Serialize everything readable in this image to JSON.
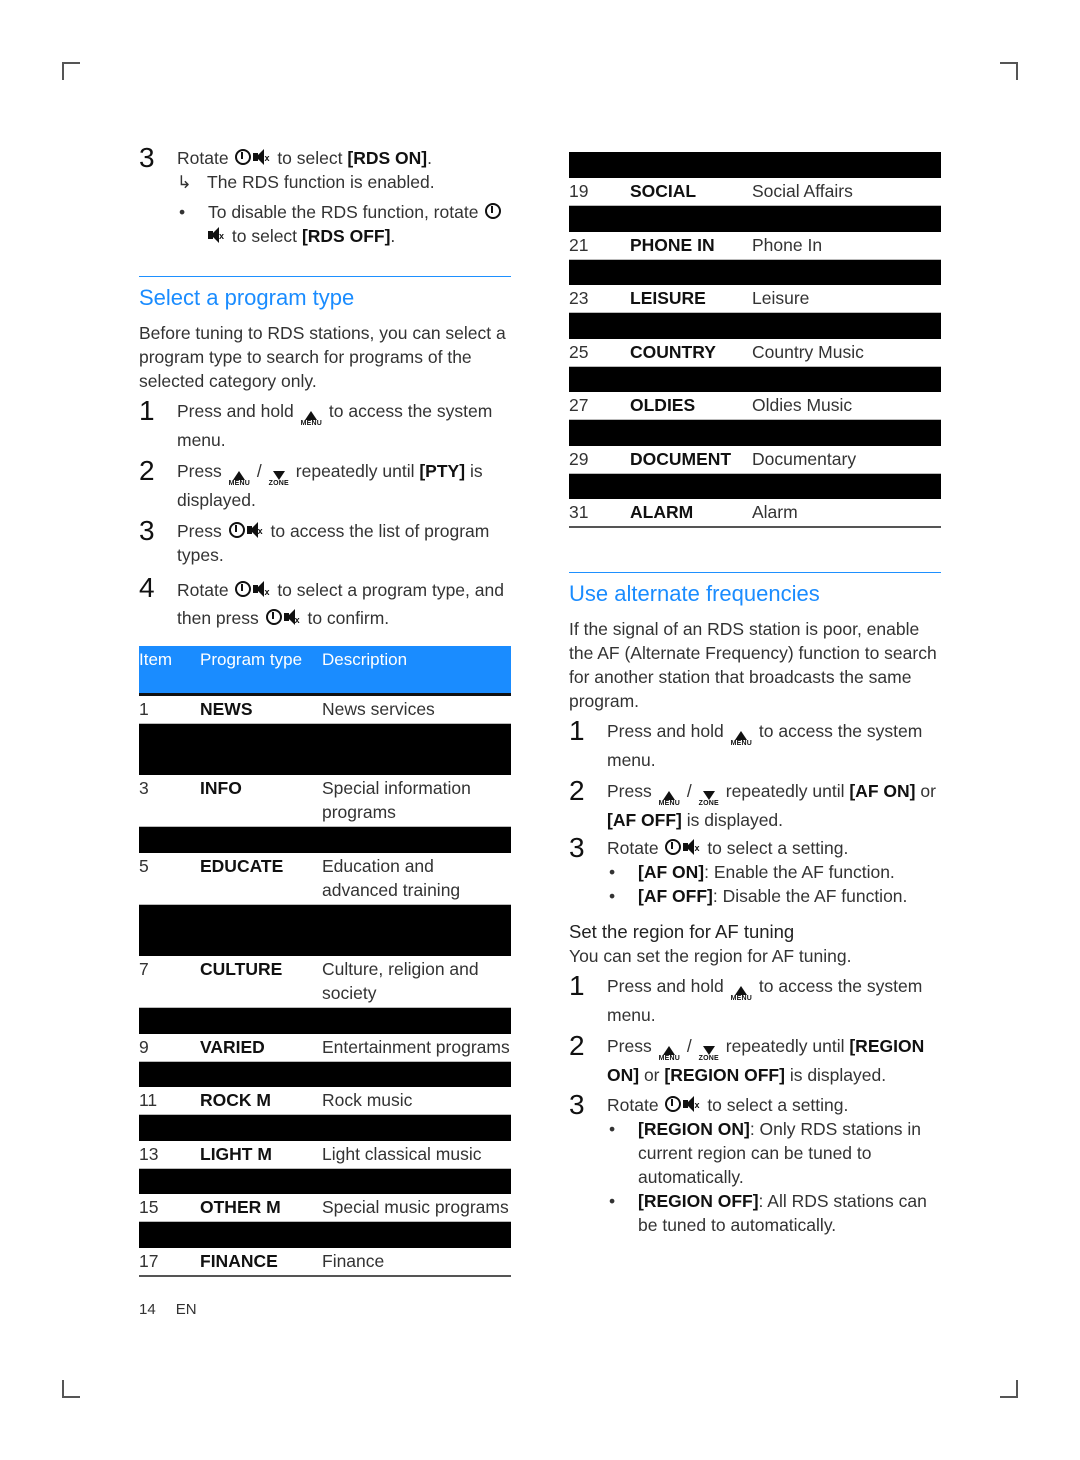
{
  "left": {
    "intro_step": {
      "number": "3",
      "text_before": "Rotate",
      "text_after": "to select",
      "option": "[RDS ON]",
      "result_marker": "↳",
      "result": "The RDS function is enabled.",
      "bullet_text": "To disable the RDS function, rotate",
      "bullet_text_after": "to select",
      "bullet_option": "[RDS OFF]"
    },
    "section": {
      "title": "Select a program type",
      "intro": "Before tuning to RDS stations, you can select a program type to search for programs of the selected category only.",
      "steps": [
        {
          "number": "1",
          "before": "Press and hold",
          "after": "to access the system menu."
        },
        {
          "number": "2",
          "before": "Press",
          "sep": "/",
          "after": "repeatedly until",
          "option": "[PTY]",
          "tail": "is displayed."
        },
        {
          "number": "3",
          "before": "Press",
          "after": "to access the list of program types."
        },
        {
          "number": "4",
          "before": "Rotate",
          "after": "to select a program type, and then press",
          "tail": "to confirm."
        }
      ]
    },
    "table": {
      "headers": {
        "item": "Item",
        "program_type": "Program type",
        "description": "Description"
      },
      "rows": [
        {
          "item": "1",
          "type": "NEWS",
          "desc": "News services"
        },
        {
          "item": "3",
          "type": "INFO",
          "desc": "Special information programs"
        },
        {
          "item": "5",
          "type": "EDUCATE",
          "desc": "Education and advanced training"
        },
        {
          "item": "7",
          "type": "CULTURE",
          "desc": "Culture, religion and society"
        },
        {
          "item": "9",
          "type": "VARIED",
          "desc": "Entertainment programs"
        },
        {
          "item": "11",
          "type": "ROCK M",
          "desc": "Rock music"
        },
        {
          "item": "13",
          "type": "LIGHT M",
          "desc": "Light classical music"
        },
        {
          "item": "15",
          "type": "OTHER M",
          "desc": "Special music programs"
        },
        {
          "item": "17",
          "type": "FINANCE",
          "desc": "Finance"
        }
      ]
    }
  },
  "right": {
    "table": {
      "rows": [
        {
          "item": "19",
          "type": "SOCIAL",
          "desc": "Social Affairs"
        },
        {
          "item": "21",
          "type": "PHONE IN",
          "desc": "Phone In"
        },
        {
          "item": "23",
          "type": "LEISURE",
          "desc": "Leisure"
        },
        {
          "item": "25",
          "type": "COUNTRY",
          "desc": "Country Music"
        },
        {
          "item": "27",
          "type": "OLDIES",
          "desc": "Oldies Music"
        },
        {
          "item": "29",
          "type": "DOCUMENT",
          "desc": "Documentary"
        },
        {
          "item": "31",
          "type": "ALARM",
          "desc": "Alarm"
        }
      ]
    },
    "section": {
      "title": "Use alternate frequencies",
      "intro": "If the signal of an RDS station is poor, enable the AF (Alternate Frequency) function to search for another station that broadcasts the same program.",
      "steps": [
        {
          "number": "1",
          "before": "Press and hold",
          "after": "to access the system menu."
        },
        {
          "number": "2",
          "before": "Press",
          "sep": "/",
          "after": "repeatedly until",
          "option": "[AF ON]",
          "mid": "or",
          "option2": "[AF OFF]",
          "tail": "is displayed."
        },
        {
          "number": "3",
          "before": "Rotate",
          "after": "to select a setting."
        }
      ],
      "bullets": [
        {
          "option": "[AF ON]",
          "text": ": Enable the AF function."
        },
        {
          "option": "[AF OFF]",
          "text": ": Disable the AF function."
        }
      ]
    },
    "subsection": {
      "title": "Set the region for AF tuning",
      "intro": "You can set the region for AF tuning.",
      "steps": [
        {
          "number": "1",
          "before": "Press and hold",
          "after": "to access the system menu."
        },
        {
          "number": "2",
          "before": "Press",
          "sep": "/",
          "after": "repeatedly until",
          "option": "[REGION ON]",
          "mid": "or",
          "option2": "[REGION OFF]",
          "tail": "is displayed."
        },
        {
          "number": "3",
          "before": "Rotate",
          "after": "to select a setting."
        }
      ],
      "bullets": [
        {
          "option": "[REGION ON]",
          "text": ": Only RDS stations in current region can be tuned to automatically."
        },
        {
          "option": "[REGION OFF]",
          "text": ": All RDS stations can be tuned to automatically."
        }
      ]
    }
  },
  "icons": {
    "menu_label": "MENU",
    "zone_label": "ZONE",
    "mute_x": "x",
    "bullet": "•"
  },
  "footer": {
    "page_number": "14",
    "language": "EN"
  },
  "colors": {
    "accent": "#1a8cff",
    "redaction": "#000000"
  }
}
